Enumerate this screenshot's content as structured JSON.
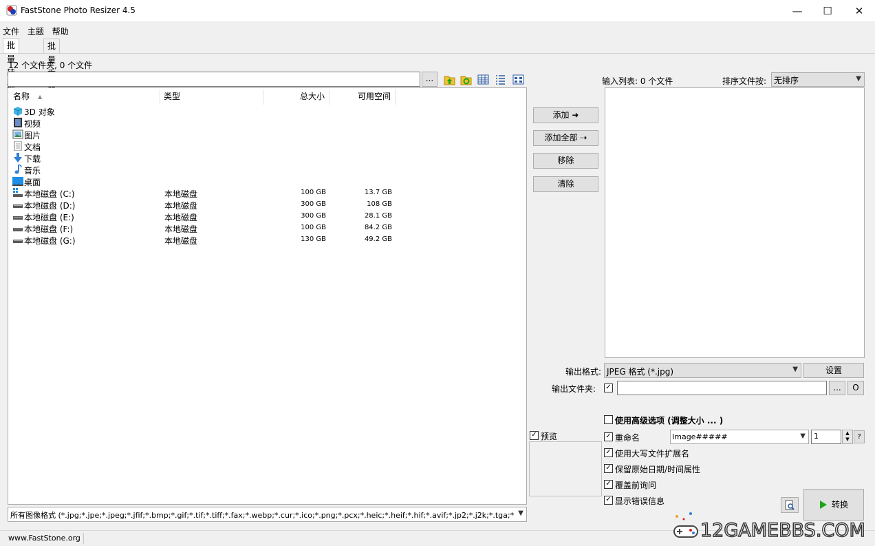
{
  "window": {
    "title": "FastStone Photo Resizer 4.5",
    "minimize": "—",
    "maximize": "☐",
    "close": "✕"
  },
  "menu": [
    "文件",
    "主题",
    "帮助"
  ],
  "tabs": [
    "批量转换",
    "批量重命名"
  ],
  "browser": {
    "summary": "12 个文件夹, 0 个文件",
    "path_value": "",
    "browse_label": "...",
    "columns": {
      "name": "名称",
      "type": "类型",
      "size": "总大小",
      "free": "可用空间"
    },
    "items": [
      {
        "name": "3D 对象",
        "type": "",
        "size": "",
        "free": "",
        "icon": "3d-objects-icon"
      },
      {
        "name": "视频",
        "type": "",
        "size": "",
        "free": "",
        "icon": "video-icon"
      },
      {
        "name": "图片",
        "type": "",
        "size": "",
        "free": "",
        "icon": "pictures-icon"
      },
      {
        "name": "文档",
        "type": "",
        "size": "",
        "free": "",
        "icon": "documents-icon"
      },
      {
        "name": "下载",
        "type": "",
        "size": "",
        "free": "",
        "icon": "download-icon"
      },
      {
        "name": "音乐",
        "type": "",
        "size": "",
        "free": "",
        "icon": "music-icon"
      },
      {
        "name": "桌面",
        "type": "",
        "size": "",
        "free": "",
        "icon": "desktop-icon"
      },
      {
        "name": "本地磁盘 (C:)",
        "type": "本地磁盘",
        "size": "100 GB",
        "free": "13.7 GB",
        "icon": "system-drive-icon"
      },
      {
        "name": "本地磁盘 (D:)",
        "type": "本地磁盘",
        "size": "300 GB",
        "free": "108 GB",
        "icon": "drive-icon"
      },
      {
        "name": "本地磁盘 (E:)",
        "type": "本地磁盘",
        "size": "300 GB",
        "free": "28.1 GB",
        "icon": "drive-icon"
      },
      {
        "name": "本地磁盘 (F:)",
        "type": "本地磁盘",
        "size": "100 GB",
        "free": "84.2 GB",
        "icon": "drive-icon"
      },
      {
        "name": "本地磁盘 (G:)",
        "type": "本地磁盘",
        "size": "130 GB",
        "free": "49.2 GB",
        "icon": "drive-icon"
      }
    ],
    "filter": "所有图像格式 (*.jpg;*.jpe;*.jpeg;*.jfif;*.bmp;*.gif;*.tif;*.tiff;*.fax;*.webp;*.cur;*.ico;*.png;*.pcx;*.heic;*.heif;*.hif;*.avif;*.jp2;*.j2k;*.tga;*.pp"
  },
  "actions": {
    "add": "添加",
    "add_all": "添加全部",
    "remove": "移除",
    "clear": "清除"
  },
  "input_list": {
    "label": "输入列表: 0 个文件",
    "sort_label": "排序文件按:",
    "sort_value": "无排序"
  },
  "output": {
    "format_label": "输出格式:",
    "format_value": "JPEG 格式 (*.jpg)",
    "settings_label": "设置",
    "folder_label": "输出文件夹:",
    "folder_value": "",
    "folder_browse": "...",
    "folder_open": "O"
  },
  "preview": {
    "label": "预览",
    "checked": true
  },
  "options": {
    "advanced": {
      "label": "使用高级选项 (调整大小 ... )",
      "checked": false
    },
    "rename": {
      "label": "重命名",
      "checked": true,
      "pattern": "Image#####",
      "start": "1",
      "help": "?"
    },
    "uppercase_ext": {
      "label": "使用大写文件扩展名",
      "checked": true
    },
    "keep_date": {
      "label": "保留原始日期/时间属性",
      "checked": true
    },
    "ask_overwrite": {
      "label": "覆盖前询问",
      "checked": true
    },
    "show_errors": {
      "label": "显示错误信息",
      "checked": true
    }
  },
  "convert_label": "转换",
  "status": {
    "website": "www.FastStone.org"
  },
  "watermark": "12GAMEBBS.COM",
  "colors": {
    "accent_green": "#1aa51a",
    "folder_yellow": "#f2c232",
    "drive_grey": "#5a5a5a"
  }
}
